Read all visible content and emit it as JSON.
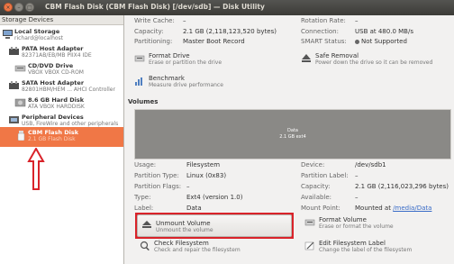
{
  "window": {
    "title": "CBM Flash Disk (CBM Flash Disk) [/dev/sdb] — Disk Utility",
    "controls": {
      "close": "×",
      "minimize": "–",
      "maximize": "□"
    }
  },
  "sidebar": {
    "header": "Storage Devices",
    "items": [
      {
        "label": "Local Storage",
        "sub": "richard@localhost",
        "icon": "computer-icon"
      },
      {
        "label": "PATA Host Adapter",
        "sub": "82371AB/EB/MB PIIX4 IDE",
        "icon": "adapter-icon"
      },
      {
        "label": "CD/DVD Drive",
        "sub": "VBOX VBOX CD-ROM",
        "icon": "optical-drive-icon"
      },
      {
        "label": "SATA Host Adapter",
        "sub": "82801HBM/HEM ... AHCI Controller",
        "icon": "adapter-icon"
      },
      {
        "label": "8.6 GB Hard Disk",
        "sub": "ATA VBOX HARDDISK",
        "icon": "hard-disk-icon"
      },
      {
        "label": "Peripheral Devices",
        "sub": "USB, FireWire and other peripherals",
        "icon": "peripheral-icon"
      },
      {
        "label": "CBM Flash Disk",
        "sub": "2.1 GB Flash Disk",
        "icon": "flash-disk-icon",
        "selected": true
      }
    ]
  },
  "drive": {
    "write_cache": {
      "label": "Write Cache:",
      "value": "–"
    },
    "capacity": {
      "label": "Capacity:",
      "value": "2.1 GB (2,118,123,520 bytes)"
    },
    "partitioning": {
      "label": "Partitioning:",
      "value": "Master Boot Record"
    },
    "rotation_rate": {
      "label": "Rotation Rate:",
      "value": "–"
    },
    "connection": {
      "label": "Connection:",
      "value": "USB at 480.0 MB/s"
    },
    "smart_status": {
      "label": "SMART Status:",
      "value": "Not Supported"
    }
  },
  "drive_actions": [
    {
      "title": "Format Drive",
      "sub": "Erase or partition the drive"
    },
    {
      "title": "Safe Removal",
      "sub": "Power down the drive so it can be removed"
    },
    {
      "title": "Benchmark",
      "sub": "Measure drive performance"
    }
  ],
  "volumes": {
    "header": "Volumes",
    "bar_label1": "Data",
    "bar_label2": "2.1 GB ext4"
  },
  "volume": {
    "usage": {
      "label": "Usage:",
      "value": "Filesystem"
    },
    "partition_type": {
      "label": "Partition Type:",
      "value": "Linux (0x83)"
    },
    "partition_flags": {
      "label": "Partition Flags:",
      "value": "–"
    },
    "type": {
      "label": "Type:",
      "value": "Ext4 (version 1.0)"
    },
    "vol_label": {
      "label": "Label:",
      "value": "Data"
    },
    "device": {
      "label": "Device:",
      "value": "/dev/sdb1"
    },
    "partition_label": {
      "label": "Partition Label:",
      "value": "–"
    },
    "capacity": {
      "label": "Capacity:",
      "value": "2.1 GB (2,116,023,296 bytes)"
    },
    "available": {
      "label": "Available:",
      "value": "–"
    },
    "mount_point": {
      "label": "Mount Point:",
      "prefix": "Mounted at",
      "link": "/media/Data"
    }
  },
  "volume_actions": [
    {
      "title": "Unmount Volume",
      "sub": "Unmount the volume"
    },
    {
      "title": "Format Volume",
      "sub": "Erase or format the volume"
    },
    {
      "title": "Check Filesystem",
      "sub": "Check and repair the filesystem"
    },
    {
      "title": "Edit Filesystem Label",
      "sub": "Change the label of the filesystem"
    }
  ],
  "colors": {
    "selection": "#f07746",
    "annotation": "#d9232a",
    "volume_bar": "#8a8986"
  }
}
